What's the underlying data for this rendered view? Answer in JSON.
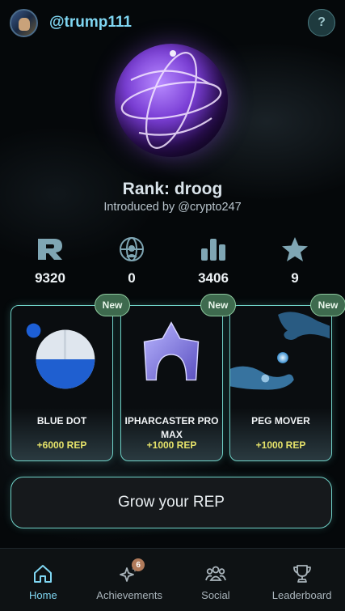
{
  "header": {
    "username": "@trump111",
    "help_label": "?"
  },
  "profile": {
    "rank_text": "Rank: droog",
    "introduced_text": "Introduced by @crypto247"
  },
  "stats": [
    {
      "icon": "rep-letter-r-icon",
      "value": "9320"
    },
    {
      "icon": "network-globe-icon",
      "value": "0"
    },
    {
      "icon": "bar-chart-icon",
      "value": "3406"
    },
    {
      "icon": "star-icon",
      "value": "9"
    }
  ],
  "cards": [
    {
      "badge": "New",
      "title": "BLUE DOT",
      "rep": "+6000 REP",
      "art": "blue-dot-pie"
    },
    {
      "badge": "New",
      "title": "IPHARCASTER PRO MAX",
      "rep": "+1000 REP",
      "art": "arch-star"
    },
    {
      "badge": "New",
      "title": "PEG MOVER",
      "rep": "+1000 REP",
      "art": "hands-orb"
    }
  ],
  "actions": {
    "grow_label": "Grow your REP"
  },
  "nav": {
    "items": [
      {
        "label": "Home",
        "icon": "home-icon",
        "active": true
      },
      {
        "label": "Achievements",
        "icon": "sparkles-icon",
        "badge": "6"
      },
      {
        "label": "Social",
        "icon": "people-icon"
      },
      {
        "label": "Leaderboard",
        "icon": "trophy-icon"
      }
    ]
  },
  "colors": {
    "accent": "#7fd6f2",
    "card_border": "#6fd0c6",
    "rep_yellow": "#e6e36a",
    "badge_green": "#3e6a4e"
  }
}
